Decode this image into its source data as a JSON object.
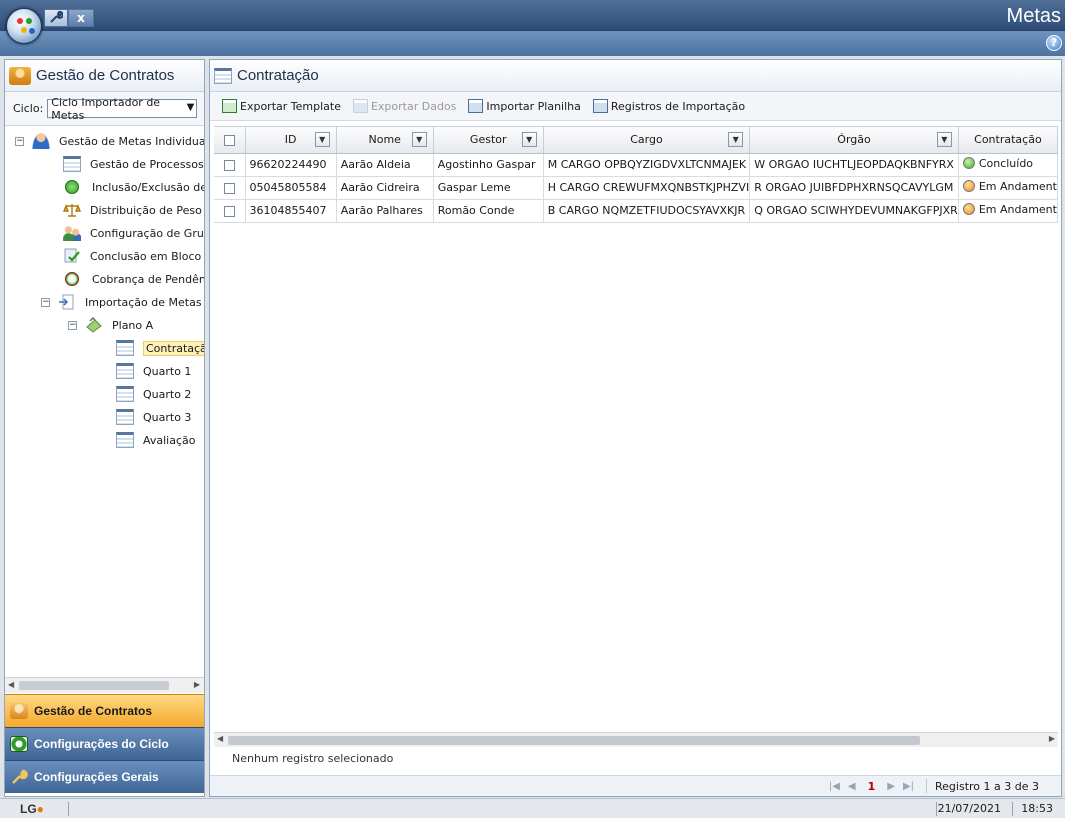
{
  "app": {
    "title": "Metas",
    "help_label": "?"
  },
  "quick_tabs": [
    {
      "icon": "wrench-icon"
    },
    {
      "label": "x"
    }
  ],
  "left_panel": {
    "title": "Gestão de Contratos",
    "cycle_label": "Ciclo:",
    "cycle_value": "Ciclo Importador de Metas",
    "tree": [
      {
        "label": "Gestão de Metas Individuais",
        "level": 0,
        "expanded": true,
        "icon": "person-icon"
      },
      {
        "label": "Gestão de Processos",
        "level": 1,
        "icon": "page-icon"
      },
      {
        "label": "Inclusão/Exclusão de Co",
        "level": 1,
        "icon": "add-circle-icon"
      },
      {
        "label": "Distribuição de Peso nos",
        "level": 1,
        "icon": "balance-icon"
      },
      {
        "label": "Configuração de Grupos",
        "level": 1,
        "icon": "group-icon"
      },
      {
        "label": "Conclusão em Bloco de",
        "level": 1,
        "icon": "check-page-icon"
      },
      {
        "label": "Cobrança de Pendência",
        "level": 1,
        "icon": "clock-icon"
      },
      {
        "label": "Importação de Metas In",
        "level": 1,
        "expanded": true,
        "icon": "import-icon"
      },
      {
        "label": "Plano A",
        "level": 2,
        "expanded": true,
        "icon": "plan-icon"
      },
      {
        "label": "Contratação",
        "level": 3,
        "icon": "page-icon",
        "selected": true
      },
      {
        "label": "Quarto 1",
        "level": 3,
        "icon": "page-icon"
      },
      {
        "label": "Quarto 2",
        "level": 3,
        "icon": "page-icon"
      },
      {
        "label": "Quarto 3",
        "level": 3,
        "icon": "page-icon"
      },
      {
        "label": "Avaliação",
        "level": 3,
        "icon": "page-icon"
      }
    ],
    "nav": [
      {
        "label": "Gestão de Contratos",
        "active": true
      },
      {
        "label": "Configurações do Ciclo",
        "active": false
      },
      {
        "label": "Configurações Gerais",
        "active": false
      }
    ]
  },
  "main": {
    "title": "Contratação",
    "toolbar": [
      {
        "label": "Exportar Template",
        "enabled": true
      },
      {
        "label": "Exportar Dados",
        "enabled": false
      },
      {
        "label": "Importar Planilha",
        "enabled": true
      },
      {
        "label": "Registros de Importação",
        "enabled": true
      }
    ],
    "columns": [
      "ID",
      "Nome",
      "Gestor",
      "Cargo",
      "Órgão",
      "Contratação"
    ],
    "rows": [
      {
        "id": "96620224490",
        "nome": "Aarão Aldeia",
        "gestor": "Agostinho Gaspar",
        "cargo": "M CARGO OPBQYZIGDVXLTCNMAJEK",
        "orgao": "W ORGAO IUCHTLJEOPDAQKBNFYRX",
        "contratacao": "Concluído",
        "status_color": "#3fb02a"
      },
      {
        "id": "05045805584",
        "nome": "Aarão Cidreira",
        "gestor": "Gaspar Leme",
        "cargo": "H CARGO CREWUFMXQNBSTKJPHZVI",
        "orgao": "R ORGAO JUIBFDPHXRNSQCAVYLGM",
        "contratacao": "Em Andament",
        "status_color": "#f08a1c"
      },
      {
        "id": "36104855407",
        "nome": "Aarão Palhares",
        "gestor": "Romão Conde",
        "cargo": "B CARGO NQMZETFIUDOCSYAVXKJR",
        "orgao": "Q ORGAO SCIWHYDEVUMNAKGFPJXR",
        "contratacao": "Em Andament",
        "status_color": "#f08a1c"
      }
    ],
    "selection_info": "Nenhum registro selecionado",
    "pager": {
      "current_page": "1",
      "summary": "Registro 1 a 3 de 3"
    }
  },
  "status_bar": {
    "logo": "LG",
    "date": "21/07/2021",
    "time": "18:53"
  }
}
